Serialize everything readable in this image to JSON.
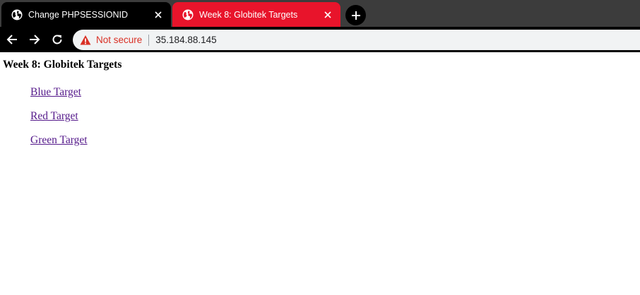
{
  "browser": {
    "tabs": [
      {
        "title": "Change PHPSESSIONID",
        "icon": "globe-icon",
        "active": false
      },
      {
        "title": "Week 8: Globitek Targets",
        "icon": "globe-icon",
        "active": true
      }
    ],
    "address_bar": {
      "security_label": "Not secure",
      "url": "35.184.88.145"
    }
  },
  "page": {
    "heading": "Week 8: Globitek Targets",
    "links": [
      {
        "label": "Blue Target"
      },
      {
        "label": "Red Target"
      },
      {
        "label": "Green Target"
      }
    ]
  },
  "colors": {
    "tab_strip": "#3c3c3c",
    "inactive_tab": "#000000",
    "active_tab": "#e8142b",
    "toolbar": "#000000",
    "omnibox": "#f1f3f4",
    "not_secure": "#d93025",
    "visited_link": "#551a8b"
  }
}
